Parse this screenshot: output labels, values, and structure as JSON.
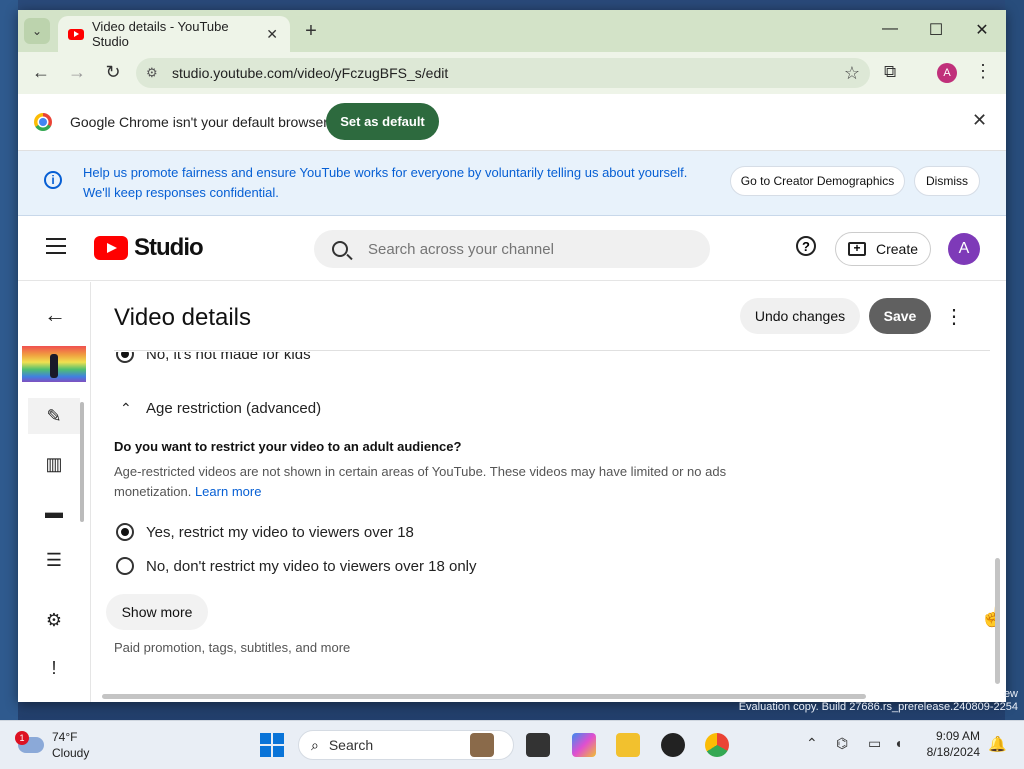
{
  "browser": {
    "tab_title": "Video details - YouTube Studio",
    "tab_close": "✕",
    "new_tab": "+",
    "minimize": "—",
    "maximize": "☐",
    "close": "✕",
    "url": "studio.youtube.com/video/yFczugBFS_s/edit",
    "profile_initial": "A"
  },
  "default_bar": {
    "message": "Google Chrome isn't your default browser",
    "button": "Set as default"
  },
  "banner": {
    "text": "Help us promote fairness and ensure YouTube works for everyone by voluntarily telling us about yourself. We'll keep responses confidential.",
    "primary": "Go to Creator Demographics",
    "dismiss": "Dismiss"
  },
  "studio_header": {
    "logo_text": "Studio",
    "search_placeholder": "Search across your channel",
    "create_label": "Create",
    "avatar_initial": "A"
  },
  "page": {
    "title": "Video details",
    "undo": "Undo changes",
    "save": "Save"
  },
  "form": {
    "made_for_kids_no": "No, it's not made for kids",
    "age_section": "Age restriction (advanced)",
    "question": "Do you want to restrict your video to an adult audience?",
    "description": "Age-restricted videos are not shown in certain areas of YouTube. These videos may have limited or no ads monetization.",
    "learn_more": "Learn more",
    "option_yes": "Yes, restrict my video to viewers over 18",
    "option_no": "No, don't restrict my video to viewers over 18 only",
    "selected": "yes",
    "show_more": "Show more",
    "show_more_hint": "Paid promotion, tags, subtitles, and more"
  },
  "taskbar": {
    "temperature": "74°F",
    "weather": "Cloudy",
    "weather_badge": "1",
    "search": "Search",
    "time": "9:09 AM",
    "date": "8/18/2024"
  },
  "watermark": {
    "line1": "ew",
    "line2": "Evaluation copy. Build 27686.rs_prerelease.240809-2254"
  },
  "colors": {
    "accent_link": "#065fd4",
    "set_default_bg": "#2d6a3e",
    "save_bg": "#606060",
    "youtube_red": "#ff0000"
  }
}
